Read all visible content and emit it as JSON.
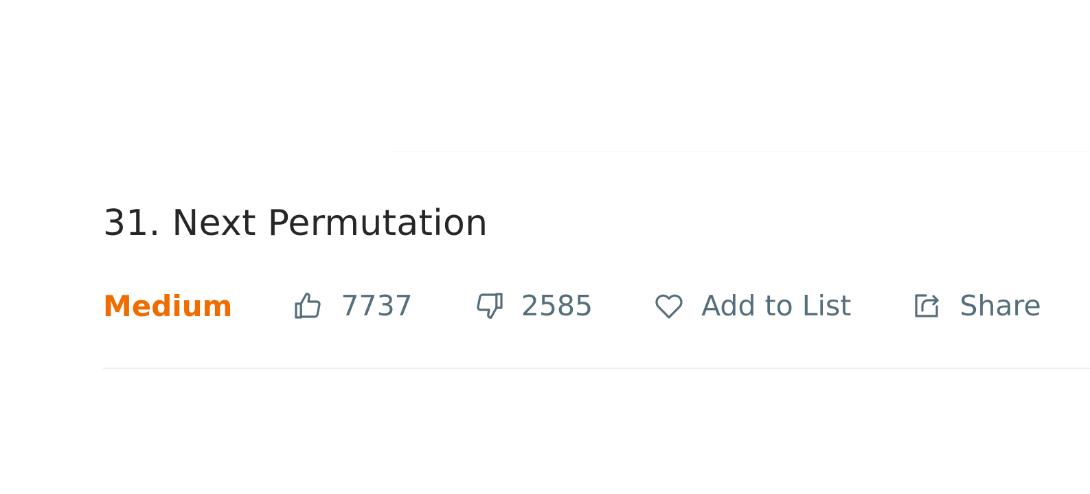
{
  "question": {
    "title": "31. Next Permutation",
    "difficulty": "Medium",
    "likes": "7737",
    "dislikes": "2585",
    "add_to_list_label": "Add to List",
    "share_label": "Share"
  },
  "colors": {
    "difficulty_medium": "#ef6c00",
    "meta_text": "#546e7a",
    "title_text": "#262626"
  },
  "icons": {
    "like": "thumbs-up-icon",
    "dislike": "thumbs-down-icon",
    "add_to_list": "heart-icon",
    "share": "share-icon"
  }
}
